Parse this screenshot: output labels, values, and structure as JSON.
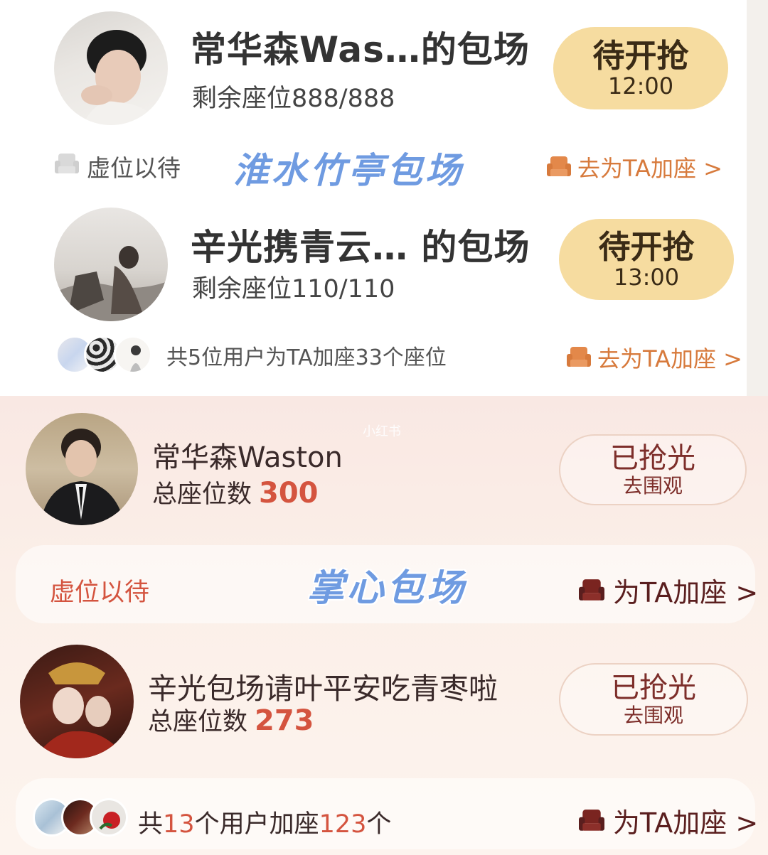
{
  "section_top": {
    "card1": {
      "title": "常华森Was…的包场",
      "seats": "剩余座位888/888",
      "button_main": "待开抢",
      "button_time": "12:00",
      "row_left": "虚位以待",
      "row_link": "去为TA加座 >"
    },
    "overlay_label": "淮水竹亭包场",
    "card2": {
      "title": "辛光携青云…   的包场",
      "seats": "剩余座位110/110",
      "button_main": "待开抢",
      "button_time": "13:00",
      "row_left": "共5位用户为TA加座33个座位",
      "row_link": "去为TA加座 >"
    }
  },
  "section_bottom": {
    "watermark": "小红书",
    "card3": {
      "title": "常华森Waston",
      "count_label": "总座位数",
      "count_value": "300",
      "button_main": "已抢光",
      "button_sub": "去围观",
      "row_left": "虚位以待",
      "row_link": "为TA加座 >"
    },
    "overlay_label": "掌心包场",
    "card4": {
      "title": "辛光包场请叶平安吃青枣啦",
      "count_label": "总座位数",
      "count_value": "273",
      "button_main": "已抢光",
      "button_sub": "去围观",
      "row_left_prefix": "共",
      "row_left_num1": "13",
      "row_left_mid": "个用户加座",
      "row_left_num2": "123",
      "row_left_suffix": "个",
      "row_link": "为TA加座 >"
    }
  },
  "colors": {
    "gold_button": "#f6dca0",
    "orange_link": "#d77a3c",
    "overlay_blue": "#6f9be1",
    "count_red": "#d4543f",
    "dark_red": "#7d2e2a"
  }
}
